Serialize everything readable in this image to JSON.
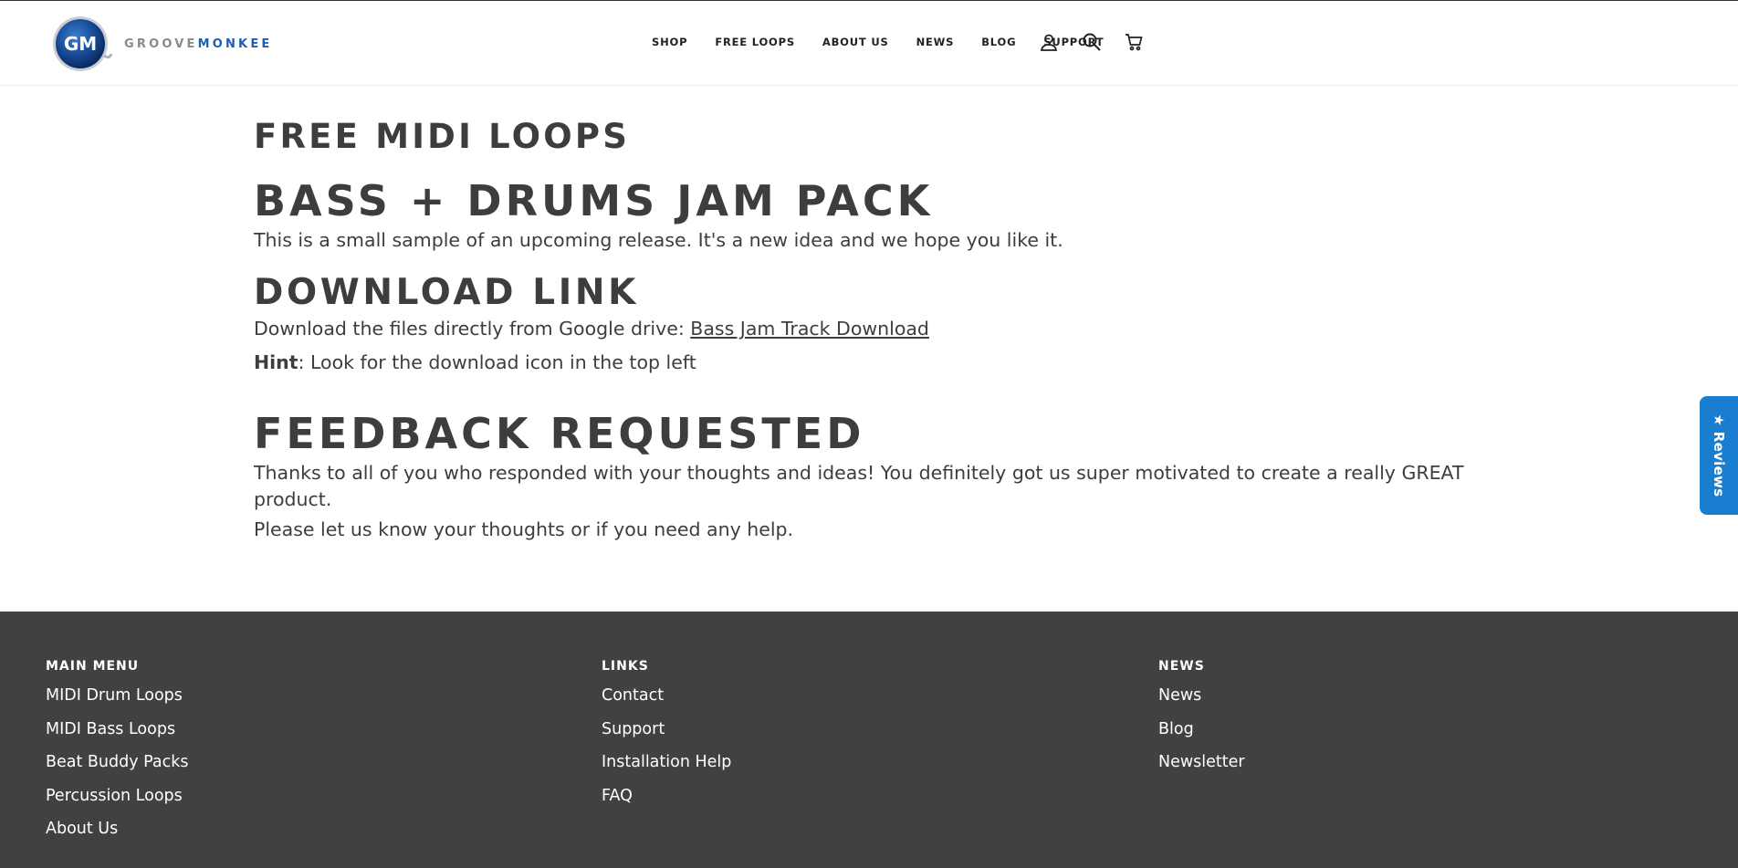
{
  "header": {
    "logo": {
      "badge_text": "GM",
      "brand_part1": "GROOVE",
      "brand_part2": "MONKEE"
    },
    "nav": [
      {
        "label": "SHOP"
      },
      {
        "label": "FREE LOOPS"
      },
      {
        "label": "ABOUT US"
      },
      {
        "label": "NEWS"
      },
      {
        "label": "BLOG"
      },
      {
        "label": "SUPPORT"
      }
    ],
    "icons": [
      "account-icon",
      "search-icon",
      "cart-icon"
    ]
  },
  "main": {
    "title": "FREE MIDI LOOPS",
    "pack_heading": "BASS + DRUMS JAM PACK",
    "pack_description": "This is a small sample of an upcoming release. It's a new idea and we hope you like it.",
    "download_heading": "DOWNLOAD LINK",
    "download_text": "Download the files directly from Google drive: ",
    "download_link": "Bass Jam Track Download",
    "hint_label": "Hint",
    "hint_text": ": Look for the download icon in the top left",
    "feedback_heading": "FEEDBACK REQUESTED",
    "feedback_text": "Thanks to all of you who responded with your thoughts and ideas! You definitely got us super motivated to create a really GREAT product.",
    "help_text": "Please let us know your thoughts or if you need any help."
  },
  "reviews_tab": {
    "label": "★ Reviews",
    "color": "#1a7ed0"
  },
  "footer": {
    "columns": [
      {
        "heading": "MAIN MENU",
        "links": [
          "MIDI Drum Loops",
          "MIDI Bass Loops",
          "Beat Buddy Packs",
          "Percussion Loops",
          "About Us"
        ]
      },
      {
        "heading": "LINKS",
        "links": [
          "Contact",
          "Support",
          "Installation Help",
          "FAQ"
        ]
      },
      {
        "heading": "NEWS",
        "links": [
          "News",
          "Blog",
          "Newsletter"
        ]
      }
    ],
    "background": "#414141"
  }
}
